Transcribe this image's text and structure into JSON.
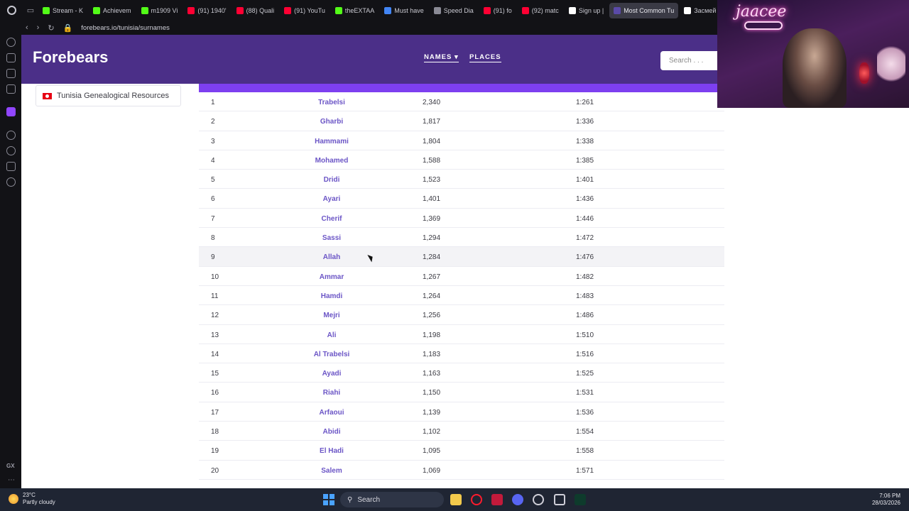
{
  "browser": {
    "tabs": [
      {
        "label": "Stream - K",
        "icon": "kick-icon",
        "color": "#53fc18",
        "active": false
      },
      {
        "label": "Achievem",
        "icon": "kick-icon",
        "color": "#53fc18",
        "active": false
      },
      {
        "label": "m1909 Vi",
        "icon": "kick-icon",
        "color": "#53fc18",
        "active": false
      },
      {
        "label": "(91) 1940'",
        "icon": "youtube-icon",
        "color": "#ff0033",
        "active": false
      },
      {
        "label": "(88) Quali",
        "icon": "youtube-icon",
        "color": "#ff0033",
        "active": false
      },
      {
        "label": "(91) YouTu",
        "icon": "youtube-icon",
        "color": "#ff0033",
        "active": false
      },
      {
        "label": "theEXTAA",
        "icon": "kick-icon",
        "color": "#53fc18",
        "active": false
      },
      {
        "label": "Must have",
        "icon": "google-icon",
        "color": "#4285f4",
        "active": false
      },
      {
        "label": "Speed Dia",
        "icon": "speed-dial-icon",
        "color": "#8a8a95",
        "active": false
      },
      {
        "label": "(91) fo",
        "icon": "youtube-icon",
        "color": "#ff0033",
        "active": false
      },
      {
        "label": "(92) matc",
        "icon": "youtube-icon",
        "color": "#ff0033",
        "active": false
      },
      {
        "label": "Sign up |",
        "icon": "tiktok-icon",
        "color": "#ffffff",
        "active": false
      },
      {
        "label": "Most Common Tu",
        "icon": "forebears-icon",
        "color": "#5a4aa8",
        "active": true
      },
      {
        "label": "Засмей",
        "icon": "tiktok-icon",
        "color": "#ffffff",
        "active": false
      }
    ],
    "url": "forebears.io/tunisia/surnames"
  },
  "site": {
    "brand": "Forebears",
    "nav_names": "NAMES",
    "nav_places": "PLACES",
    "search_placeholder": "Search . . ."
  },
  "sidebar_link": {
    "label": "Tunisia Genealogical Resources"
  },
  "table": {
    "rows": [
      {
        "rank": "1",
        "surname": "Trabelsi",
        "incidence": "2,340",
        "frequency": "1:261"
      },
      {
        "rank": "2",
        "surname": "Gharbi",
        "incidence": "1,817",
        "frequency": "1:336"
      },
      {
        "rank": "3",
        "surname": "Hammami",
        "incidence": "1,804",
        "frequency": "1:338"
      },
      {
        "rank": "4",
        "surname": "Mohamed",
        "incidence": "1,588",
        "frequency": "1:385"
      },
      {
        "rank": "5",
        "surname": "Dridi",
        "incidence": "1,523",
        "frequency": "1:401"
      },
      {
        "rank": "6",
        "surname": "Ayari",
        "incidence": "1,401",
        "frequency": "1:436"
      },
      {
        "rank": "7",
        "surname": "Cherif",
        "incidence": "1,369",
        "frequency": "1:446"
      },
      {
        "rank": "8",
        "surname": "Sassi",
        "incidence": "1,294",
        "frequency": "1:472"
      },
      {
        "rank": "9",
        "surname": "Allah",
        "incidence": "1,284",
        "frequency": "1:476"
      },
      {
        "rank": "10",
        "surname": "Ammar",
        "incidence": "1,267",
        "frequency": "1:482"
      },
      {
        "rank": "11",
        "surname": "Hamdi",
        "incidence": "1,264",
        "frequency": "1:483"
      },
      {
        "rank": "12",
        "surname": "Mejri",
        "incidence": "1,256",
        "frequency": "1:486"
      },
      {
        "rank": "13",
        "surname": "Ali",
        "incidence": "1,198",
        "frequency": "1:510"
      },
      {
        "rank": "14",
        "surname": "Al Trabelsi",
        "incidence": "1,183",
        "frequency": "1:516"
      },
      {
        "rank": "15",
        "surname": "Ayadi",
        "incidence": "1,163",
        "frequency": "1:525"
      },
      {
        "rank": "16",
        "surname": "Riahi",
        "incidence": "1,150",
        "frequency": "1:531"
      },
      {
        "rank": "17",
        "surname": "Arfaoui",
        "incidence": "1,139",
        "frequency": "1:536"
      },
      {
        "rank": "18",
        "surname": "Abidi",
        "incidence": "1,102",
        "frequency": "1:554"
      },
      {
        "rank": "19",
        "surname": "El Hadi",
        "incidence": "1,095",
        "frequency": "1:558"
      },
      {
        "rank": "20",
        "surname": "Salem",
        "incidence": "1,069",
        "frequency": "1:571"
      }
    ]
  },
  "webcam": {
    "neon_sign": "jaacee"
  },
  "taskbar": {
    "temperature": "23°C",
    "weather": "Partly cloudy",
    "search_label": "Search",
    "time": "7:06 PM",
    "date": "28/03/2026"
  }
}
